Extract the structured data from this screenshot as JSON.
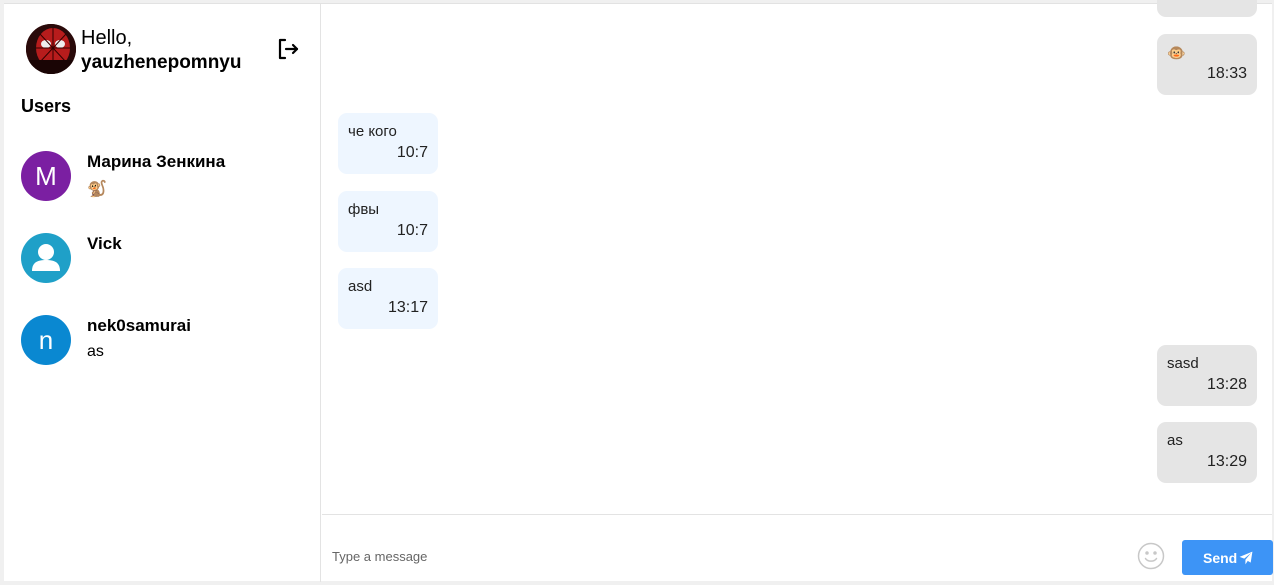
{
  "profile": {
    "greeting": "Hello,",
    "username": "yauzhenepomnyu",
    "avatar_icon": "spiderman-avatar"
  },
  "sidebar": {
    "logout_icon": "logout-icon",
    "users_title": "Users",
    "users": [
      {
        "name": "Марина Зенкина",
        "initial": "М",
        "last_message": "🐒",
        "color": "#7b1fa2"
      },
      {
        "name": "Vick",
        "initial": "",
        "last_message": "",
        "color": "#1fa0c8",
        "avatar_icon": "person-icon"
      },
      {
        "name": "nek0samurai",
        "initial": "n",
        "last_message": "as",
        "color": "#0a88d1"
      }
    ]
  },
  "messages": [
    {
      "direction": "out",
      "text": "",
      "time": ""
    },
    {
      "direction": "out",
      "text": "🐵",
      "time": "18:33"
    },
    {
      "direction": "in",
      "text": "че кого",
      "time": "10:7"
    },
    {
      "direction": "in",
      "text": "фвы",
      "time": "10:7"
    },
    {
      "direction": "in",
      "text": "asd",
      "time": "13:17"
    },
    {
      "direction": "out",
      "text": "sasd",
      "time": "13:28"
    },
    {
      "direction": "out",
      "text": "as",
      "time": "13:29"
    }
  ],
  "composer": {
    "placeholder": "Type a message",
    "value": "",
    "emoji_icon": "smiley-icon",
    "send_label": "Send",
    "send_icon": "paper-plane-icon"
  },
  "colors": {
    "accent": "#3d94f6",
    "incoming_bubble": "#eef6ff",
    "outgoing_bubble": "#e5e5e5"
  }
}
